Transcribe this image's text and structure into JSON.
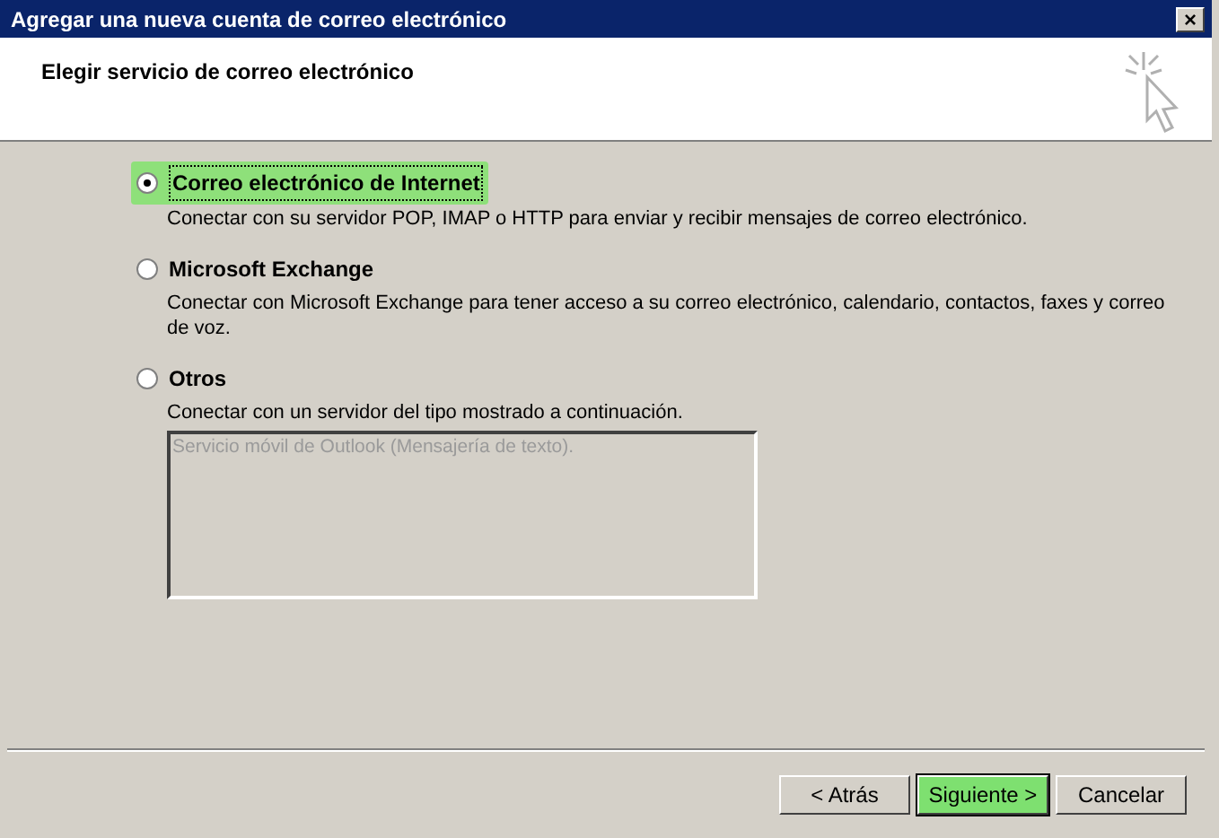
{
  "window": {
    "title": "Agregar una nueva cuenta de correo electrónico",
    "close": "×"
  },
  "header": {
    "title": "Elegir servicio de correo electrónico"
  },
  "options": [
    {
      "label": "Correo electrónico de Internet",
      "description": "Conectar con su servidor POP, IMAP o HTTP para enviar y recibir mensajes de correo electrónico.",
      "selected": true
    },
    {
      "label": "Microsoft Exchange",
      "description": "Conectar con Microsoft Exchange para tener acceso a su correo electrónico, calendario, contactos, faxes y correo de voz.",
      "selected": false
    },
    {
      "label": "Otros",
      "description": "Conectar con un servidor del tipo mostrado a continuación.",
      "selected": false,
      "list": [
        "Servicio móvil de Outlook (Mensajería de texto)."
      ]
    }
  ],
  "buttons": [
    {
      "label": "< Atrás",
      "highlighted": false
    },
    {
      "label": "Siguiente >",
      "highlighted": true
    },
    {
      "label": "Cancelar",
      "highlighted": false
    }
  ]
}
